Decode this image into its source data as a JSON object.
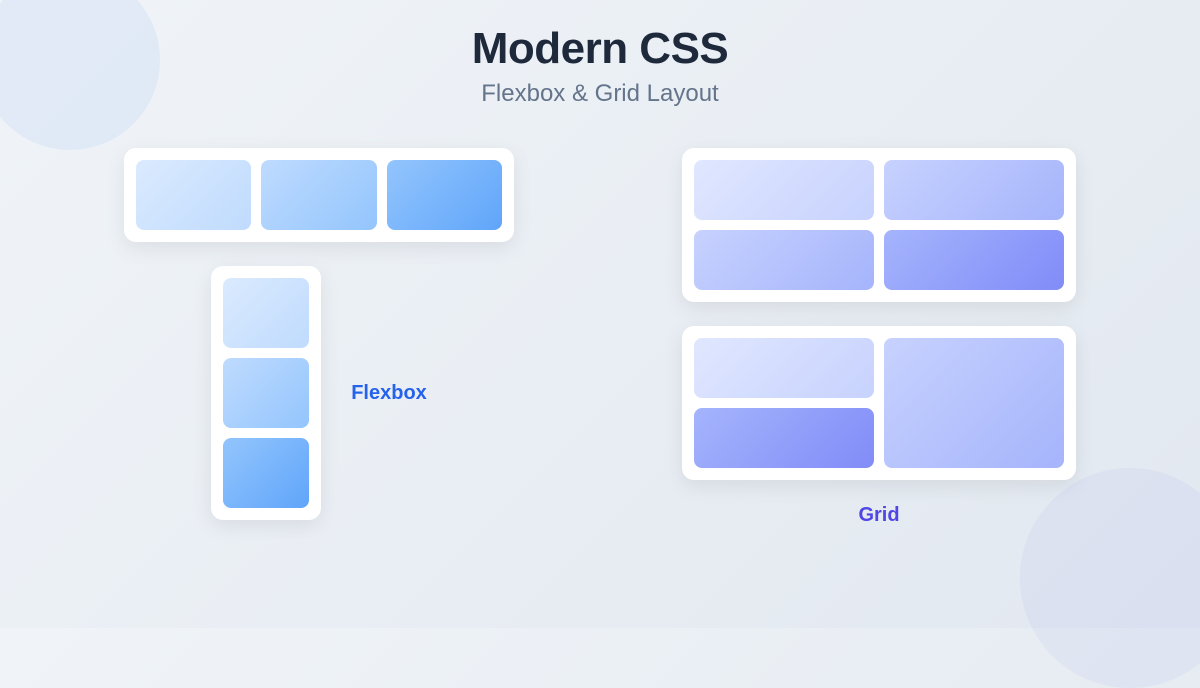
{
  "header": {
    "title": "Modern CSS",
    "subtitle": "Flexbox & Grid Layout"
  },
  "labels": {
    "flexbox": "Flexbox",
    "grid": "Grid"
  }
}
